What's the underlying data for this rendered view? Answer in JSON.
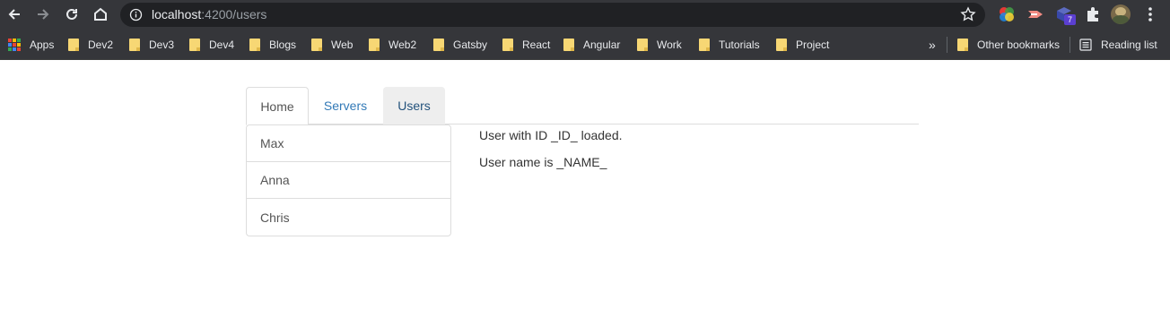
{
  "browser": {
    "url_host": "localhost",
    "url_path": ":4200/users",
    "extension_badge": "7",
    "bookmarks": [
      "Apps",
      "Dev2",
      "Dev3",
      "Dev4",
      "Blogs",
      "Web",
      "Web2",
      "Gatsby",
      "React",
      "Angular",
      "Work",
      "Tutorials",
      "Project"
    ],
    "overflow_label": "»",
    "other_bookmarks": "Other bookmarks",
    "reading_list": "Reading list"
  },
  "tabs": [
    {
      "label": "Home"
    },
    {
      "label": "Servers"
    },
    {
      "label": "Users"
    }
  ],
  "users": [
    {
      "name": "Max"
    },
    {
      "name": "Anna"
    },
    {
      "name": "Chris"
    }
  ],
  "detail": {
    "id_line": "User with ID _ID_ loaded.",
    "name_line": "User name is _NAME_"
  },
  "colors": {
    "link": "#337ab7",
    "active_tab_bg": "#eeeeee",
    "border": "#dddddd",
    "chrome_bg": "#35363a"
  }
}
